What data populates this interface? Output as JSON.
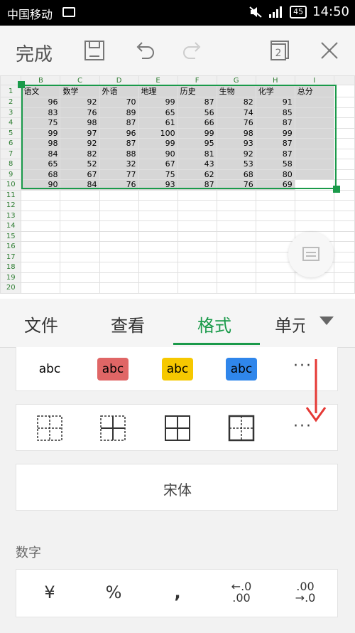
{
  "status_bar": {
    "carrier": "中国移动",
    "battery": "45",
    "time": "14:50"
  },
  "toolbar": {
    "done_label": "完成",
    "window_count": "2"
  },
  "sheet": {
    "columns": [
      "B",
      "C",
      "D",
      "E",
      "F",
      "G",
      "H",
      "I"
    ],
    "headers": [
      "语文",
      "数学",
      "外语",
      "地理",
      "历史",
      "生物",
      "化学",
      "总分"
    ],
    "rows": [
      [
        96,
        92,
        70,
        99,
        87,
        82,
        91
      ],
      [
        83,
        76,
        89,
        65,
        56,
        74,
        85
      ],
      [
        75,
        98,
        87,
        61,
        66,
        76,
        87
      ],
      [
        99,
        97,
        96,
        100,
        99,
        98,
        99
      ],
      [
        98,
        92,
        87,
        99,
        95,
        93,
        87
      ],
      [
        84,
        82,
        88,
        90,
        81,
        92,
        87
      ],
      [
        65,
        52,
        32,
        67,
        43,
        53,
        58
      ],
      [
        68,
        67,
        77,
        75,
        62,
        68,
        80
      ],
      [
        90,
        84,
        76,
        93,
        87,
        76,
        69
      ]
    ],
    "row_numbers": [
      "1",
      "2",
      "3",
      "4",
      "5",
      "6",
      "7",
      "8",
      "9",
      "10",
      "11",
      "12",
      "13",
      "14",
      "15",
      "16",
      "17",
      "18",
      "19",
      "20"
    ]
  },
  "tabs": [
    {
      "label": "文件"
    },
    {
      "label": "查看"
    },
    {
      "label": "格式"
    },
    {
      "label": "单元"
    }
  ],
  "font_styles": {
    "items": [
      "abc",
      "abc",
      "abc",
      "abc"
    ],
    "colors": [
      "#ffffff",
      "#e06666",
      "#f6c800",
      "#2f86eb"
    ]
  },
  "font_name": "宋体",
  "number_section": {
    "title": "数字",
    "items": [
      "¥",
      "%",
      ",",
      "←.0\n.00",
      ".00\n→.0"
    ]
  },
  "arrow_color": "#e53935"
}
